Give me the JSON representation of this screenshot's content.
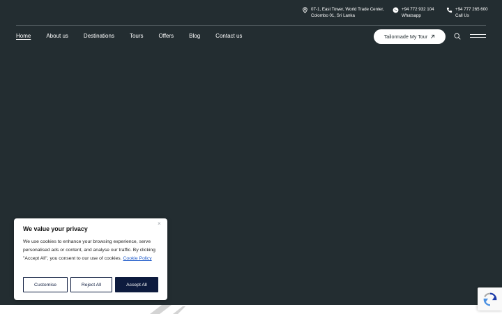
{
  "contact": {
    "address_line1": "07-1, East Tower, World Trade Center,",
    "address_line2": "Colombo 01, Sri Lanka",
    "whatsapp_number": "+94 772 932 104",
    "whatsapp_label": "Whatsapp",
    "call_number": "+94 777 265 600",
    "call_label": "Call Us"
  },
  "nav": {
    "items": [
      {
        "label": "Home"
      },
      {
        "label": "About us"
      },
      {
        "label": "Destinations"
      },
      {
        "label": "Tours"
      },
      {
        "label": "Offers"
      },
      {
        "label": "Blog"
      },
      {
        "label": "Contact us"
      }
    ],
    "cta_label": "Tailormade My Tour"
  },
  "cookie": {
    "title": "We value your privacy",
    "body": "We use cookies to enhance your browsing experience, serve personalised ads or content, and analyse our traffic. By clicking \"Accept All\", you consent to our use of cookies.",
    "link_label": "Cookie Policy",
    "customise_label": "Customise",
    "reject_label": "Reject All",
    "accept_label": "Accept All",
    "close_glyph": "×"
  },
  "colors": {
    "hero_bg": "#232d31",
    "button_navy": "#0d1b3e",
    "link_blue": "#1a57c9"
  },
  "icons": [
    "location-pin-icon",
    "whatsapp-icon",
    "phone-icon",
    "arrow-up-right-icon",
    "search-icon",
    "hamburger-menu-icon",
    "close-icon",
    "recaptcha-icon"
  ]
}
